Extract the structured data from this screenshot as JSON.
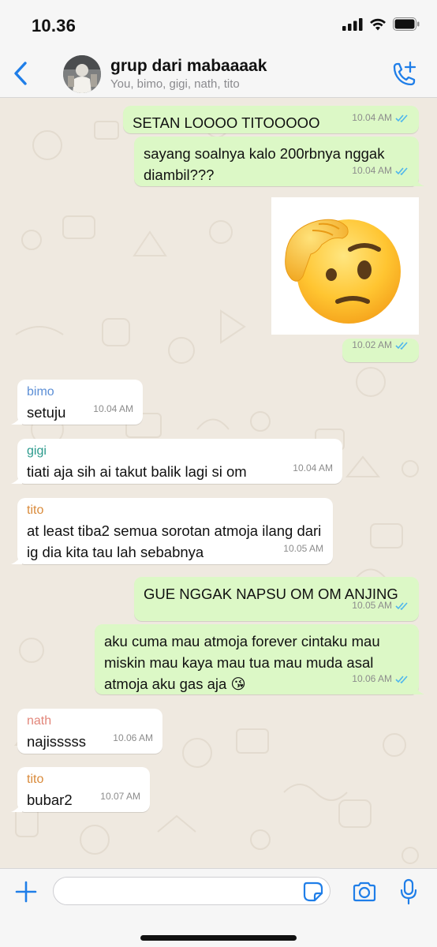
{
  "status": {
    "time": "10.36"
  },
  "header": {
    "title": "grup dari mabaaaak",
    "members": "You, bimo, gigi, nath, tito"
  },
  "colors": {
    "accent": "#1f7ee8",
    "outgoing": "#dcf8c6",
    "incoming": "#ffffff",
    "read_ticks": "#4fb6ec",
    "bimo": "#5c8fd6",
    "gigi": "#2a9a8c",
    "tito": "#d98a3a",
    "nath": "#e2867a"
  },
  "messages": [
    {
      "dir": "out",
      "text": "SETAN LOOOO TITOOOOO",
      "time": "10.04 AM"
    },
    {
      "dir": "out",
      "text": "sayang soalnya kalo 200rbnya nggak diambil???",
      "time": "10.04 AM"
    },
    {
      "dir": "out",
      "type": "sticker",
      "sticker": "face-with-hand-on-head",
      "time": "10.02 AM"
    },
    {
      "dir": "in",
      "sender": "bimo",
      "text": "setuju",
      "time": "10.04 AM"
    },
    {
      "dir": "in",
      "sender": "gigi",
      "text": "tiati aja sih ai takut balik lagi si om",
      "time": "10.04 AM"
    },
    {
      "dir": "in",
      "sender": "tito",
      "text": "at least tiba2 semua sorotan atmoja ilang dari ig dia kita tau lah sebabnya",
      "time": "10.05 AM"
    },
    {
      "dir": "out",
      "text": "GUE NGGAK NAPSU OM OM ANJING",
      "time": "10.05 AM"
    },
    {
      "dir": "out",
      "text": "aku cuma mau atmoja forever cintaku mau miskin mau kaya mau tua mau muda asal atmoja aku gas aja 😘",
      "time": "10.06 AM"
    },
    {
      "dir": "in",
      "sender": "nath",
      "text": "najisssss",
      "time": "10.06 AM"
    },
    {
      "dir": "in",
      "sender": "tito",
      "text": "bubar2",
      "time": "10.07 AM"
    }
  ],
  "composer": {
    "placeholder": ""
  },
  "icons": [
    "back-chevron-icon",
    "add-call-icon",
    "plus-icon",
    "sticker-icon",
    "camera-icon",
    "microphone-icon"
  ]
}
